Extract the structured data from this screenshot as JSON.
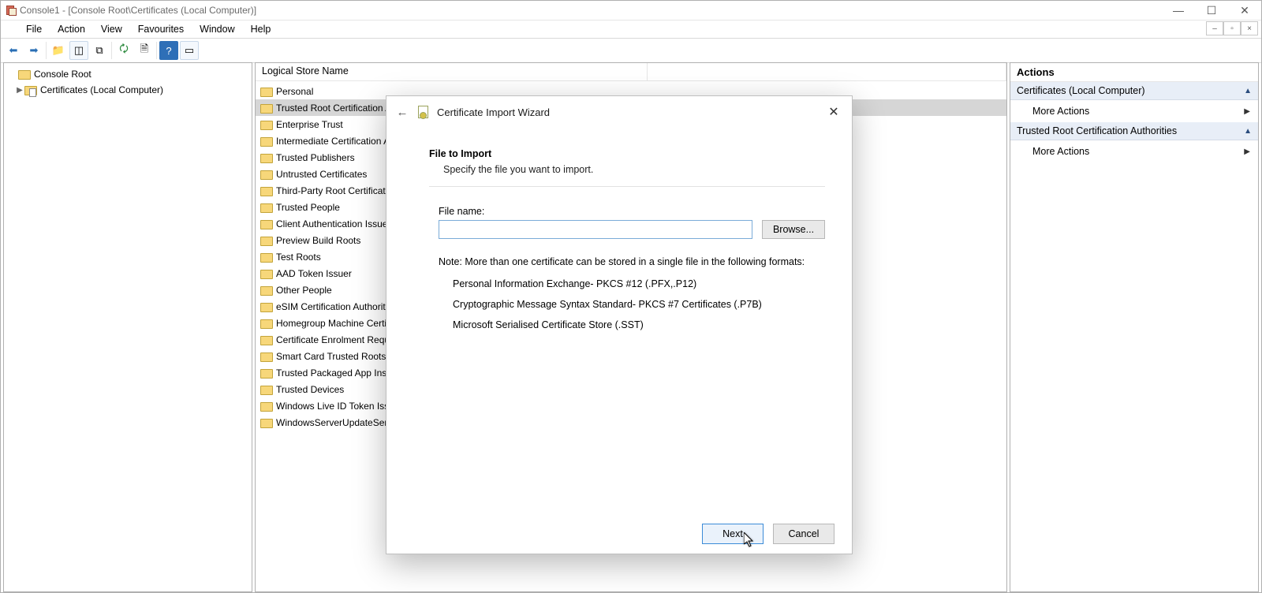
{
  "window": {
    "title": "Console1 - [Console Root\\Certificates (Local Computer)]"
  },
  "menu": {
    "items": [
      "File",
      "Action",
      "View",
      "Favourites",
      "Window",
      "Help"
    ]
  },
  "tree": {
    "root_label": "Console Root",
    "cert_label": "Certificates (Local Computer)"
  },
  "list": {
    "header": "Logical Store Name",
    "items": [
      "Personal",
      "Trusted Root Certification Authorities",
      "Enterprise Trust",
      "Intermediate Certification Authorities",
      "Trusted Publishers",
      "Untrusted Certificates",
      "Third-Party Root Certification Authorities",
      "Trusted People",
      "Client Authentication Issuers",
      "Preview Build Roots",
      "Test Roots",
      "AAD Token Issuer",
      "Other People",
      "eSIM Certification Authorities",
      "Homegroup Machine Certificates",
      "Certificate Enrolment Requests",
      "Smart Card Trusted Roots",
      "Trusted Packaged App Installation Authorities",
      "Trusted Devices",
      "Windows Live ID Token Issuer",
      "WindowsServerUpdateServices"
    ],
    "selected_index": 1
  },
  "actions": {
    "title": "Actions",
    "groups": [
      {
        "header": "Certificates (Local Computer)",
        "items": [
          "More Actions"
        ]
      },
      {
        "header": "Trusted Root Certification Authorities",
        "items": [
          "More Actions"
        ]
      }
    ]
  },
  "dialog": {
    "title": "Certificate Import Wizard",
    "section_title": "File to Import",
    "section_sub": "Specify the file you want to import.",
    "file_label": "File name:",
    "file_value": "",
    "browse": "Browse...",
    "note_lead": "Note:  More than one certificate can be stored in a single file in the following formats:",
    "note_items": [
      "Personal Information Exchange- PKCS #12 (.PFX,.P12)",
      "Cryptographic Message Syntax Standard- PKCS #7 Certificates (.P7B)",
      "Microsoft Serialised Certificate Store (.SST)"
    ],
    "next": "Next",
    "cancel": "Cancel"
  }
}
